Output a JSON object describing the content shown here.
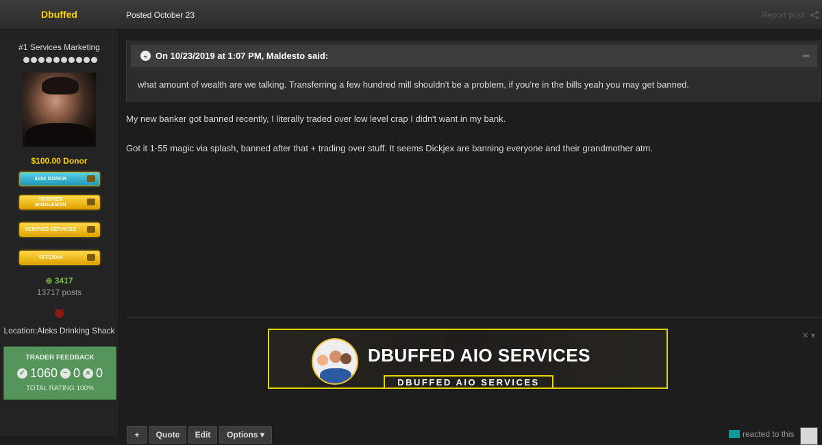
{
  "header": {
    "username": "Dbuffed",
    "posted": "Posted October 23",
    "report": "Report post"
  },
  "profile": {
    "rank": "#1 Services Marketing",
    "donor_title": "$100.00 Donor",
    "badges": [
      "$100 DONOR",
      "VERIFIED MIDDLEMAN",
      "VERIFIED SERVICES",
      "VETERAN"
    ],
    "reputation": "3417",
    "posts": "13717 posts",
    "location": "Location:Aleks Drinking Shack"
  },
  "feedback": {
    "title": "TRADER FEEDBACK",
    "positive": "1060",
    "neutral": "0",
    "negative": "0",
    "total": "TOTAL RATING 100%"
  },
  "quote": {
    "cite": "On 10/23/2019 at 1:07 PM, Maldesto said:",
    "body": "what amount of wealth are we talking. Transferring a few hundred mill shouldn't be a problem, if you're in the bills yeah you may get banned."
  },
  "post": {
    "paragraphs": [
      "My new banker got banned recently, I literally traded over low level crap I didn't want in my bank.",
      "Got it 1-55 magic via splash, banned after that + trading over stuff. It seems Dickjex are banning everyone and their grandmother atm."
    ]
  },
  "signature": {
    "title": "DBUFFED AIO SERVICES",
    "subtitle": "DBUFFED AIO SERVICES"
  },
  "actions": {
    "add": "+",
    "quote": "Quote",
    "edit": "Edit",
    "options": "Options ▾",
    "reacted": "reacted to this"
  },
  "colors": {
    "username": "#ffd200",
    "feedback_bg": "#55955b",
    "banner_border": "#e6d400"
  },
  "icons": [
    "share-icon",
    "chevron-down-icon",
    "forward-icon",
    "plus-circle-icon",
    "check-icon",
    "minus-icon",
    "x-icon",
    "close-icon",
    "devil-icon"
  ]
}
